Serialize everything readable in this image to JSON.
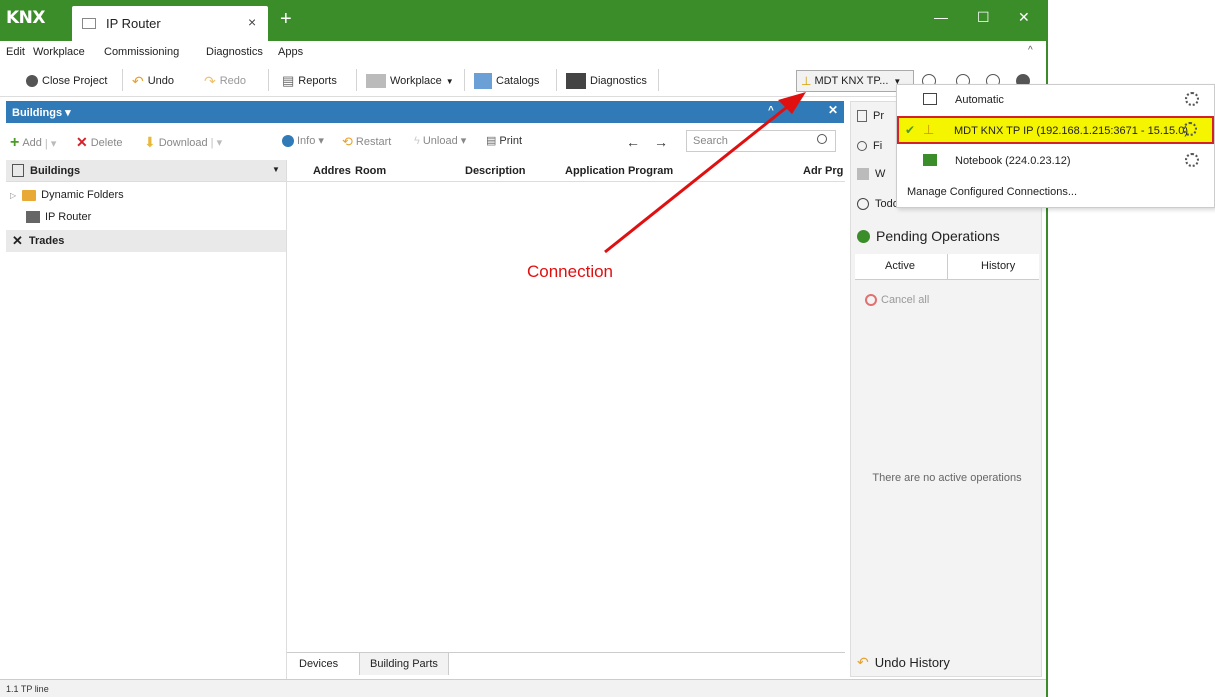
{
  "titlebar": {
    "logo": "KNX",
    "tab_label": "IP Router",
    "tab_close": "×",
    "new_tab": "+"
  },
  "menu": {
    "items": [
      "Edit",
      "Workplace",
      "Commissioning",
      "Diagnostics",
      "Apps"
    ]
  },
  "toolbar": {
    "close_project": "Close Project",
    "undo": "Undo",
    "redo": "Redo",
    "reports": "Reports",
    "workplace": "Workplace",
    "catalogs": "Catalogs",
    "diagnostics": "Diagnostics",
    "connection": "MDT KNX TP..."
  },
  "buildings_panel": {
    "title": "Buildings",
    "add": "Add",
    "delete": "Delete",
    "download": "Download",
    "info": "Info",
    "restart": "Restart",
    "unload": "Unload",
    "print": "Print",
    "search_placeholder": "Search"
  },
  "tree": {
    "header": "Buildings",
    "items": [
      "Dynamic Folders",
      "IP Router",
      "Trades"
    ]
  },
  "grid": {
    "columns": [
      "Addres",
      "Room",
      "Description",
      "Application Program",
      "Adr Prg"
    ],
    "tabs": [
      "Devices",
      "Building Parts"
    ]
  },
  "side_panel": {
    "item_pr": "Pr",
    "item_fi": "Fi",
    "item_w": "W",
    "todo": "Todo Items",
    "pending": "Pending Operations",
    "tab_active": "Active",
    "tab_history": "History",
    "cancel_all": "Cancel all",
    "no_ops": "There are no active operations",
    "undo_history": "Undo History"
  },
  "dropdown": {
    "automatic": "Automatic",
    "mdt": "MDT KNX TP IP (192.168.1.215:3671 - 15.15.0)",
    "notebook": "Notebook (224.0.23.12)",
    "manage": "Manage Configured Connections..."
  },
  "statusbar": {
    "text": "1.1 TP line"
  },
  "annotation": {
    "label": "Connection"
  },
  "colors": {
    "titlebar": "#3a8d28",
    "panel_header": "#2f7ab7",
    "highlight": "#f5f500",
    "highlight_border": "#d4222a",
    "annotation": "#e01010"
  }
}
